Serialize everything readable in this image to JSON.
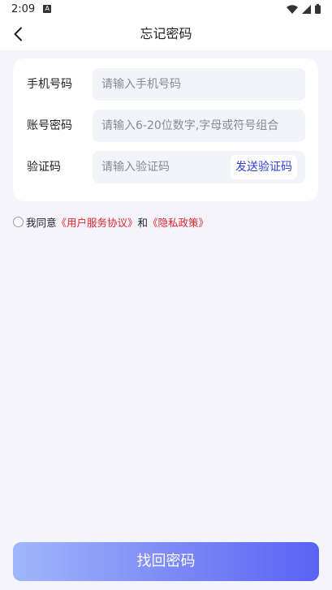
{
  "status_bar": {
    "time": "2:09",
    "notification_icon_letter": "A"
  },
  "header": {
    "title": "忘记密码",
    "back_icon": "chevron-left-icon"
  },
  "form": {
    "phone": {
      "label": "手机号码",
      "placeholder": "请输入手机号码",
      "value": ""
    },
    "password": {
      "label": "账号密码",
      "placeholder": "请输入6-20位数字,字母或符号组合",
      "value": ""
    },
    "code": {
      "label": "验证码",
      "placeholder": "请输入验证码",
      "value": "",
      "send_label": "发送验证码"
    }
  },
  "agreement": {
    "prefix": "我同意",
    "user_agreement": "《用户服务协议》",
    "conjunction": "和",
    "privacy_policy": "《隐私政策》",
    "checked": false
  },
  "submit_label": "找回密码",
  "colors": {
    "background": "#f5f4fc",
    "link": "#e0262b",
    "send_code": "#2f3fd6",
    "button_start": "#9fb7fb",
    "button_end": "#5a62f4"
  }
}
